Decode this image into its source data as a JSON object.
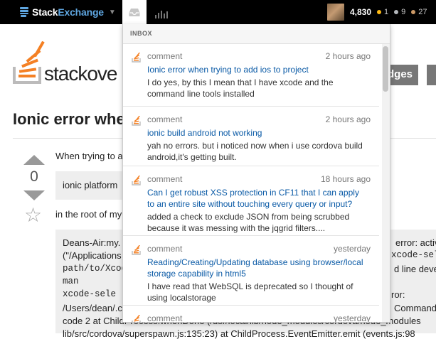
{
  "topbar": {
    "brand_prefix": "Stack",
    "brand_suffix": "Exchange",
    "reputation": "4,830",
    "gold_count": "1",
    "silver_count": "9",
    "bronze_count": "27",
    "badge_colors": {
      "gold": "#fcb913",
      "silver": "#b4b8bc",
      "bronze": "#cc9966"
    }
  },
  "page": {
    "logo_text": "stackove",
    "nav_badges": "dges",
    "question_title": "Ionic error whe",
    "vote_count": "0",
    "body_line_1": "When trying to a",
    "code_1": "ionic platform",
    "body_line_2": "in the root of my",
    "code_left": [
      "Deans-Air:my.",
      "(\"/Applications",
      "path/to/Xcod",
      " man",
      "  xcode-sele",
      "/Users/dean/.c",
      "code 2 at ChildProcess.whenDone (/usr/local/lib/node_modules/cordova/node_modules",
      "lib/src/cordova/superspawn.js:135:23) at ChildProcess.EventEmitter.emit (events.js:98"
    ],
    "code_right": [
      "error: activ",
      "xcode-sel",
      "d line deve",
      "",
      "ror:",
      "Command"
    ]
  },
  "inbox": {
    "header": "INBOX",
    "items": [
      {
        "type": "comment",
        "time": "2 hours ago",
        "title": "Ionic error when trying to add ios to project",
        "summary": "I do yes, by this I mean that I have xcode and the command line tools installed"
      },
      {
        "type": "comment",
        "time": "2 hours ago",
        "title": "ionic build android not working",
        "summary": "yah no errors. but i noticed now when i use cordova build android,it's getting built."
      },
      {
        "type": "comment",
        "time": "18 hours ago",
        "title": "Can I get robust XSS protection in CF11 that I can apply to an entire site without touching every query or input?",
        "summary": "added a check to exclude JSON from being scrubbed because it was messing with the jqgrid filters...."
      },
      {
        "type": "comment",
        "time": "yesterday",
        "title": "Reading/Creating/Updating database using browser/local storage capability in html5",
        "summary": "I have read that WebSQL is deprecated so I thought of using localstorage"
      },
      {
        "type": "comment",
        "time": "yesterday",
        "title": "",
        "summary": ""
      }
    ]
  }
}
